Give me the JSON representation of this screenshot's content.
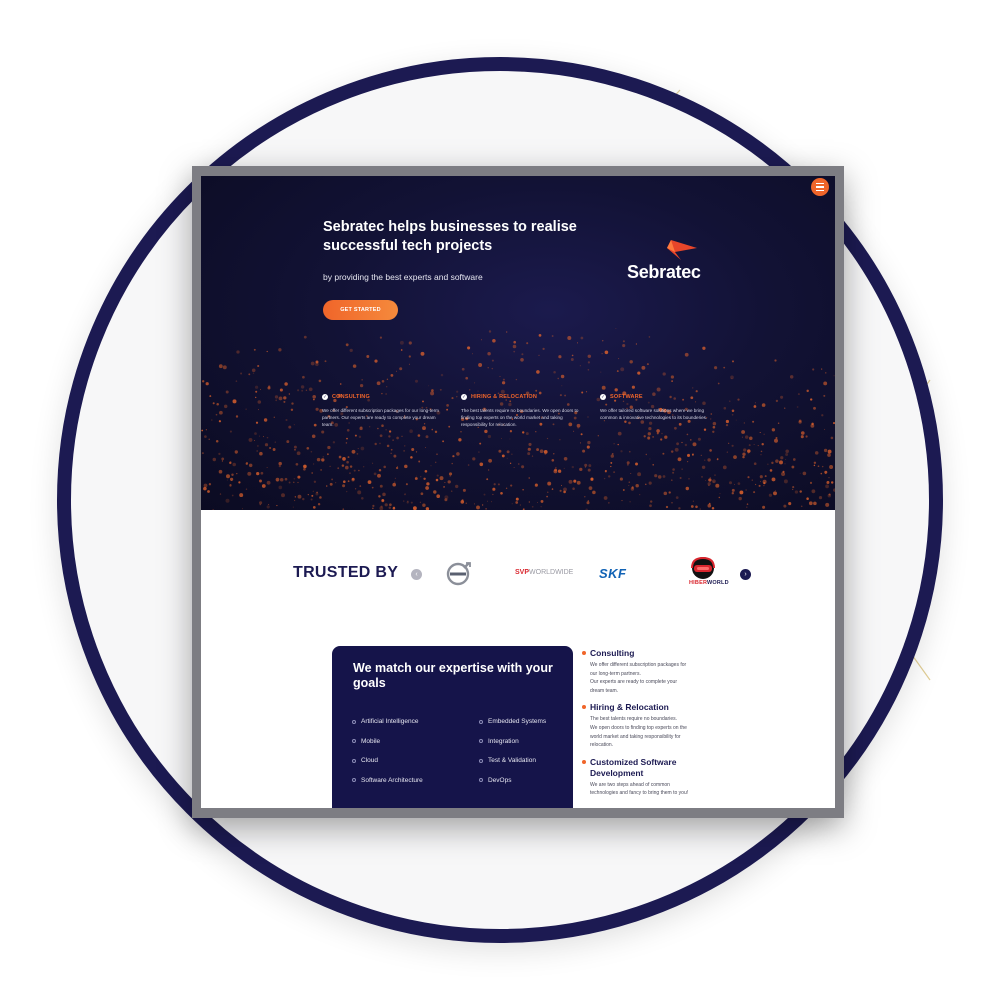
{
  "hero": {
    "title": "Sebratec helps businesses to realise successful tech projects",
    "subtitle": "by providing the best experts and software",
    "cta_label": "GET STARTED",
    "brand": "Sebratec",
    "services": [
      {
        "name": "CONSULTING",
        "desc": "We offer different subscription packages for our long-term partners. Our experts are ready to complete your dream team."
      },
      {
        "name": "HIRING & RELOCATION",
        "desc": "The best talents require no boundaries. We open doors to finding top experts on the world market and taking responsibility for relocation."
      },
      {
        "name": "SOFTWARE",
        "desc": "We offer tailored software solutions where we bring common & innovative technologies to its bounderies."
      }
    ]
  },
  "trusted": {
    "title": "TRUSTED BY",
    "logos": {
      "svp_bold": "SVP",
      "svp_rest": "WORLDWIDE",
      "skf": "SKF",
      "hiber_a": "HIBER",
      "hiber_b": "WORLD"
    }
  },
  "expertise": {
    "title": "We match our expertise with your goals",
    "left": [
      "Artificial Intelligence",
      "Mobile",
      "Cloud",
      "Software Architecture"
    ],
    "right": [
      "Embedded Systems",
      "Integration",
      "Test & Validation",
      "DevOps"
    ]
  },
  "side": [
    {
      "title": "Consulting",
      "desc": [
        "We offer different subscription packages for",
        "our long-term partners.",
        "Our experts are ready to complete your",
        "dream team."
      ]
    },
    {
      "title": "Hiring & Relocation",
      "desc": [
        "The best talents require no boundaries.",
        "We open doors to finding top experts on the",
        "world market and taking responsibility for",
        "relocation."
      ]
    },
    {
      "title": "Customized Software Development",
      "desc": [
        "We are two steps ahead of common",
        "technologies and fancy to bring them to you!"
      ]
    }
  ],
  "icons": {
    "menu": "hamburger-icon",
    "check": "check-icon",
    "prev": "chevron-left-icon",
    "next": "chevron-right-icon",
    "bullet": "bullet-icon"
  },
  "colors": {
    "navy": "#1c1a52",
    "accent": "#f0652a"
  }
}
